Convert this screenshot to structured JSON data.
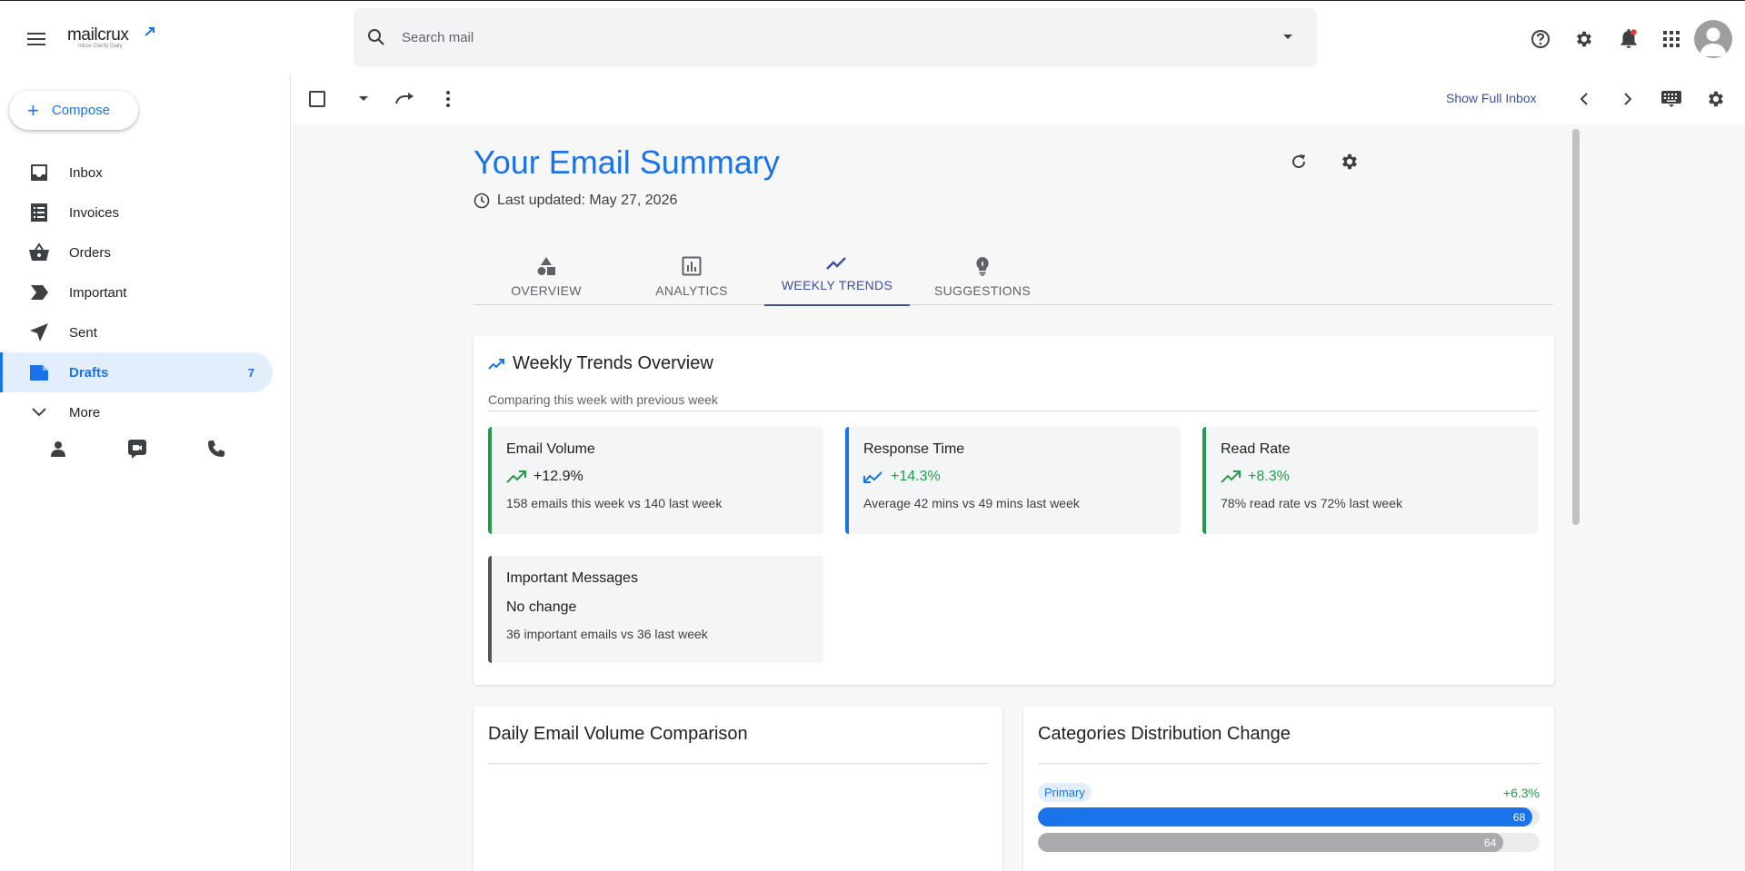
{
  "app": {
    "logo_text": "mailcrux",
    "logo_tagline": "Inbox Clarity Daily"
  },
  "search": {
    "placeholder": "Search mail"
  },
  "compose": {
    "label": "Compose"
  },
  "sidebar": {
    "items": [
      {
        "label": "Inbox",
        "icon": "inbox-icon"
      },
      {
        "label": "Invoices",
        "icon": "invoice-icon"
      },
      {
        "label": "Orders",
        "icon": "basket-icon"
      },
      {
        "label": "Important",
        "icon": "important-icon"
      },
      {
        "label": "Sent",
        "icon": "send-icon"
      },
      {
        "label": "Drafts",
        "icon": "drafts-icon",
        "count": "7",
        "active": true
      },
      {
        "label": "More",
        "icon": "chevron-down-icon"
      }
    ]
  },
  "toolbar": {
    "show_full_inbox": "Show Full Inbox"
  },
  "summary": {
    "title": "Your Email Summary",
    "last_updated": "Last updated: May 27, 2026"
  },
  "tabs": [
    {
      "label": "OVERVIEW",
      "icon": "shapes-icon"
    },
    {
      "label": "ANALYTICS",
      "icon": "bar-chart-icon"
    },
    {
      "label": "WEEKLY TRENDS",
      "icon": "trend-icon",
      "active": true
    },
    {
      "label": "SUGGESTIONS",
      "icon": "lightbulb-icon"
    }
  ],
  "weekly": {
    "title": "Weekly Trends Overview",
    "subtitle": "Comparing this week with previous week",
    "metrics": [
      {
        "title": "Email Volume",
        "value": "+12.9%",
        "desc": "158 emails this week vs 140 last week"
      },
      {
        "title": "Response Time",
        "value": "+14.3%",
        "desc": "Average 42 mins vs 49 mins last week"
      },
      {
        "title": "Read Rate",
        "value": "+8.3%",
        "desc": "78% read rate vs 72% last week"
      },
      {
        "title": "Important Messages",
        "value": "No change",
        "desc": "36 important emails vs 36 last week"
      }
    ]
  },
  "daily": {
    "title": "Daily Email Volume Comparison"
  },
  "categories": {
    "title": "Categories Distribution Change",
    "rows": [
      {
        "label": "Primary",
        "change": "+6.3%",
        "current": 68,
        "previous": 64
      }
    ]
  },
  "colors": {
    "accent": "#1a73e8",
    "positive": "#1e9e4a",
    "tab_active": "#3b4fa0"
  }
}
